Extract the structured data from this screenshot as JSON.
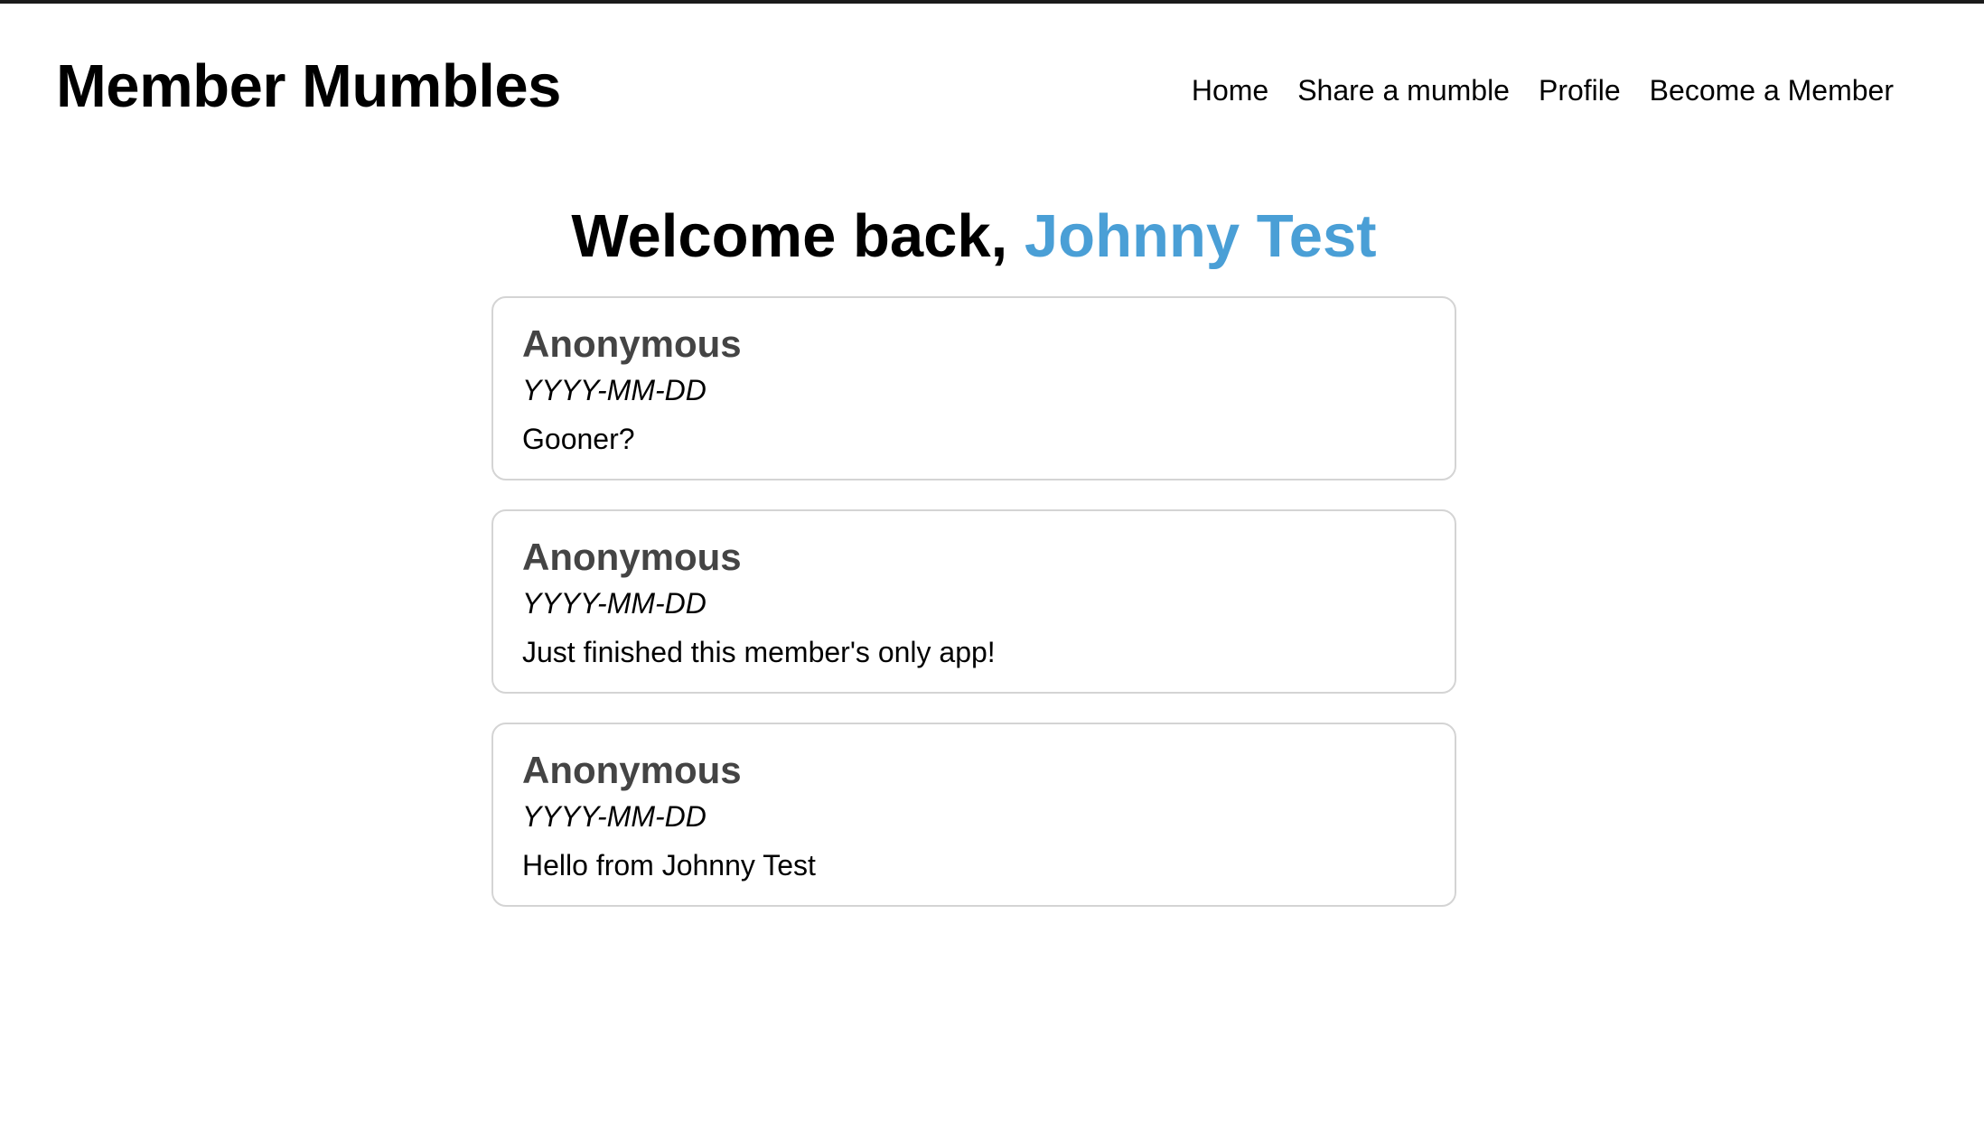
{
  "header": {
    "title": "Member Mumbles",
    "nav": [
      {
        "label": "Home"
      },
      {
        "label": "Share a mumble"
      },
      {
        "label": "Profile"
      },
      {
        "label": "Become a Member"
      }
    ]
  },
  "welcome": {
    "prefix": "Welcome back, ",
    "username": "Johnny Test",
    "username_color": "#4a9fd6"
  },
  "messages": [
    {
      "author": "Anonymous",
      "date": "YYYY-MM-DD",
      "text": "Gooner?"
    },
    {
      "author": "Anonymous",
      "date": "YYYY-MM-DD",
      "text": "Just finished this member's only app!"
    },
    {
      "author": "Anonymous",
      "date": "YYYY-MM-DD",
      "text": "Hello from Johnny Test"
    }
  ]
}
